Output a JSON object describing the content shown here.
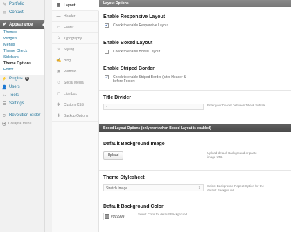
{
  "sidebar": {
    "top_items": [
      {
        "label": "Portfolio",
        "icon": "pin-icon"
      },
      {
        "label": "Contact",
        "icon": "mail-icon"
      }
    ],
    "current": {
      "label": "Appearance",
      "icon": "paintbrush-icon"
    },
    "submenu": [
      "Themes",
      "Widgets",
      "Menus",
      "Theme Check",
      "Sidebars",
      "Theme Options",
      "Editor"
    ],
    "submenu_current_index": 5,
    "bottom_items": [
      {
        "label": "Plugins",
        "icon": "plug-icon",
        "badge": "5"
      },
      {
        "label": "Users",
        "icon": "users-icon"
      },
      {
        "label": "Tools",
        "icon": "wrench-icon"
      },
      {
        "label": "Settings",
        "icon": "settings-icon"
      }
    ],
    "slider": {
      "label": "Revolution Slider",
      "icon": "slider-icon"
    },
    "collapse": "Collapse menu"
  },
  "optnav": [
    {
      "label": "Layout",
      "icon": "layout-icon",
      "active": true
    },
    {
      "label": "Header",
      "icon": "header-icon"
    },
    {
      "label": "Footer",
      "icon": "footer-icon"
    },
    {
      "label": "Typography",
      "icon": "typography-icon"
    },
    {
      "label": "Styling",
      "icon": "styling-icon"
    },
    {
      "label": "Blog",
      "icon": "blog-icon"
    },
    {
      "label": "Portfolio",
      "icon": "portfolio-icon"
    },
    {
      "label": "Social Media",
      "icon": "social-icon"
    },
    {
      "label": "Lightbox",
      "icon": "lightbox-icon"
    },
    {
      "label": "Custom CSS",
      "icon": "css-icon"
    },
    {
      "label": "Backup Options",
      "icon": "backup-icon"
    }
  ],
  "main": {
    "header": "Layout Options",
    "responsive": {
      "title": "Enable Responsive Layout",
      "check_label": "Check to enable Responsive Layout",
      "checked": true
    },
    "boxed": {
      "title": "Enable Boxed Layout",
      "check_label": "Check to enable Boxed Layout",
      "checked": false
    },
    "striped": {
      "title": "Enable Striped Border",
      "check_label": "Check to enable Striped Border (after Header & before Footer)",
      "checked": true
    },
    "divider": {
      "title": "Title Divider",
      "value": "-",
      "desc": "Enter your Divider between Title & Subtitle"
    },
    "boxed_bar": "Boxed Layout Options (only work when Boxed Layout is enabled)",
    "bg_image": {
      "title": "Default Background Image",
      "button": "Upload",
      "desc": "Upload default Background or paste image URL"
    },
    "stylesheet": {
      "title": "Theme Stylesheet",
      "selected": "Stretch Image",
      "desc": "Select Background Repeat Option for the default Background."
    },
    "bg_color": {
      "title": "Default Background Color",
      "value": "#999999",
      "swatch": "#999999",
      "desc": "Select Color for default Background"
    }
  }
}
